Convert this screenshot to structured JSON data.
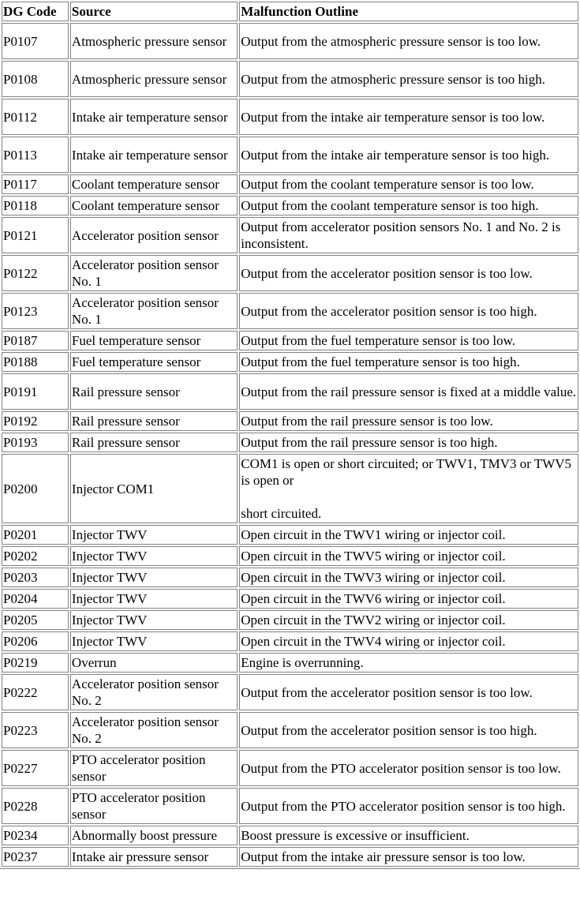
{
  "table": {
    "headers": [
      "DG Code",
      "Source",
      "Malfunction Outline"
    ],
    "rows": [
      {
        "code": "P0107",
        "source": "Atmospheric pressure sensor",
        "outline": "Output from the atmospheric pressure sensor is too low."
      },
      {
        "code": "P0108",
        "source": "Atmospheric pressure sensor",
        "outline": "Output from the atmospheric pressure sensor is too high."
      },
      {
        "code": "P0112",
        "source": "Intake air temperature sensor",
        "outline": "Output from the intake air temperature sensor is too low."
      },
      {
        "code": "P0113",
        "source": "Intake air temperature sensor",
        "outline": "Output from the intake air temperature sensor is too high."
      },
      {
        "code": "P0117",
        "source": "Coolant temperature sensor",
        "outline": "Output from the coolant temperature sensor is too low."
      },
      {
        "code": "P0118",
        "source": "Coolant temperature sensor",
        "outline": "Output from the coolant temperature sensor is too high."
      },
      {
        "code": "P0121",
        "source": "Accelerator position sensor",
        "outline": "Output from accelerator position sensors No. 1 and No. 2 is inconsistent."
      },
      {
        "code": "P0122",
        "source": "Accelerator position sensor No. 1",
        "outline": "Output from the accelerator position sensor is too low."
      },
      {
        "code": "P0123",
        "source": "Accelerator position sensor No. 1",
        "outline": "Output from the accelerator position sensor is too high."
      },
      {
        "code": "P0187",
        "source": "Fuel temperature sensor",
        "outline": "Output from the fuel temperature sensor is too low."
      },
      {
        "code": "P0188",
        "source": "Fuel temperature sensor",
        "outline": "Output from the fuel temperature sensor is too high."
      },
      {
        "code": "P0191",
        "source": "Rail pressure sensor",
        "outline": "Output from the rail pressure sensor is fixed at a middle value."
      },
      {
        "code": "P0192",
        "source": "Rail pressure sensor",
        "outline": "Output from the rail pressure sensor is too low."
      },
      {
        "code": "P0193",
        "source": "Rail pressure sensor",
        "outline": "Output from the rail pressure sensor is too high."
      },
      {
        "code": "P0200",
        "source": "Injector COM1",
        "outline": "COM1 is open or short circuited; or TWV1, TMV3 or TWV5 is open or",
        "outline_cont": "short circuited."
      },
      {
        "code": "P0201",
        "source": "Injector TWV",
        "outline": "Open circuit in the TWV1 wiring or injector coil."
      },
      {
        "code": "P0202",
        "source": "Injector TWV",
        "outline": "Open circuit in the TWV5 wiring or injector coil."
      },
      {
        "code": "P0203",
        "source": "Injector TWV",
        "outline": "Open circuit in the TWV3 wiring or injector coil."
      },
      {
        "code": "P0204",
        "source": "Injector TWV",
        "outline": "Open circuit in the TWV6 wiring or injector coil."
      },
      {
        "code": "P0205",
        "source": "Injector TWV",
        "outline": "Open circuit in the TWV2 wiring or injector coil."
      },
      {
        "code": "P0206",
        "source": "Injector TWV",
        "outline": "Open circuit in the TWV4 wiring or injector coil."
      },
      {
        "code": "P0219",
        "source": "Overrun",
        "outline": "Engine is overrunning."
      },
      {
        "code": "P0222",
        "source": "Accelerator position sensor No. 2",
        "outline": "Output from the accelerator position sensor is too low."
      },
      {
        "code": "P0223",
        "source": "Accelerator position sensor No. 2",
        "outline": "Output from the accelerator position sensor is too high."
      },
      {
        "code": "P0227",
        "source": "PTO accelerator position sensor",
        "outline": "Output from the PTO accelerator position sensor is too low."
      },
      {
        "code": "P0228",
        "source": "PTO accelerator position sensor",
        "outline": "Output from the PTO accelerator position sensor is too high."
      },
      {
        "code": "P0234",
        "source": "Abnormally boost pressure",
        "outline": "Boost pressure is excessive or insufficient."
      },
      {
        "code": "P0237",
        "source": "Intake air pressure sensor",
        "outline": "Output from the intake air pressure sensor is too low."
      }
    ]
  }
}
